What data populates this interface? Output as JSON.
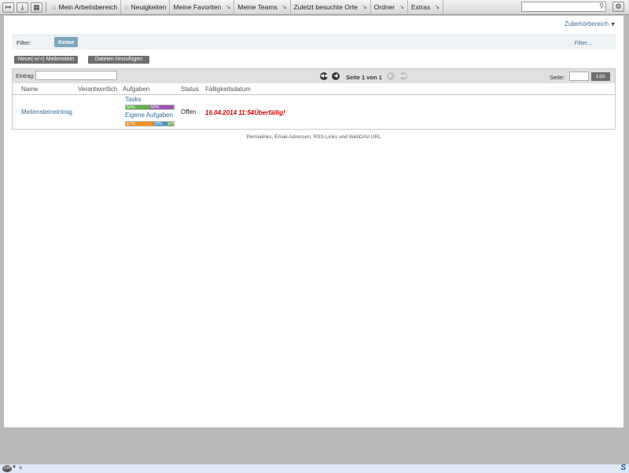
{
  "toolbar": {
    "icons": [
      "login-icon",
      "download-icon",
      "tree-icon"
    ],
    "menu": [
      {
        "label": "Mein Arbeitsbereich",
        "icon": "home-icon",
        "dropdown": false
      },
      {
        "label": "Neuigkeiten",
        "icon": "news-icon",
        "dropdown": false
      },
      {
        "label": "Meine Favoriten",
        "icon": "",
        "dropdown": true
      },
      {
        "label": "Meine Teams",
        "icon": "",
        "dropdown": true
      },
      {
        "label": "Zuletzt besuchte Orte",
        "icon": "",
        "dropdown": true
      },
      {
        "label": "Ordner",
        "icon": "",
        "dropdown": true
      },
      {
        "label": "Extras",
        "icon": "",
        "dropdown": true
      }
    ],
    "search_value": ""
  },
  "page": {
    "zubehoer_label": "Zubehörbereich",
    "filter_label": "Filter:",
    "filter_chip": "Keine",
    "filter_link": "Filter...",
    "new_button": "Neue(-s/-r) Meilenstein",
    "files_button": "Dateien hinzufügen",
    "entry_label": "Eintrag:",
    "entry_value": "",
    "pagination_text": "Seite 1 von 1",
    "page_label": "Seite:",
    "page_value": "",
    "go_button": "Los",
    "columns": [
      "Name",
      "Verantwortlich",
      "Aufgaben",
      "Status",
      "Fälligkeitsdatum"
    ],
    "row": {
      "name": "Meilensteineintrag",
      "responsible": "",
      "tasks_label": "Tasks",
      "tasks_bar": [
        {
          "label": "50%",
          "percent": 50,
          "color": "#5fae47"
        },
        {
          "label": "50%",
          "percent": 50,
          "color": "#9b55b5"
        }
      ],
      "own_tasks_label": "Eigene Aufgaben",
      "own_tasks_bar": [
        {
          "label": "57%",
          "percent": 57,
          "color": "#f0901e"
        },
        {
          "label": "28%",
          "percent": 28,
          "color": "#4a8fcf"
        },
        {
          "label": "14%",
          "percent": 15,
          "color": "#5fae47"
        }
      ],
      "status": "Offen",
      "due": "16.04.2014 11:54Überfällig!"
    },
    "footer_links": "Permalinks, Email-Adressen, RSS-Links und WebDAV-URL"
  },
  "bottombar": {
    "logo_text": "SSP"
  },
  "colors": {
    "link": "#2f6ea0",
    "overdue": "#d40000",
    "filter_chip": "#78a6bd"
  }
}
